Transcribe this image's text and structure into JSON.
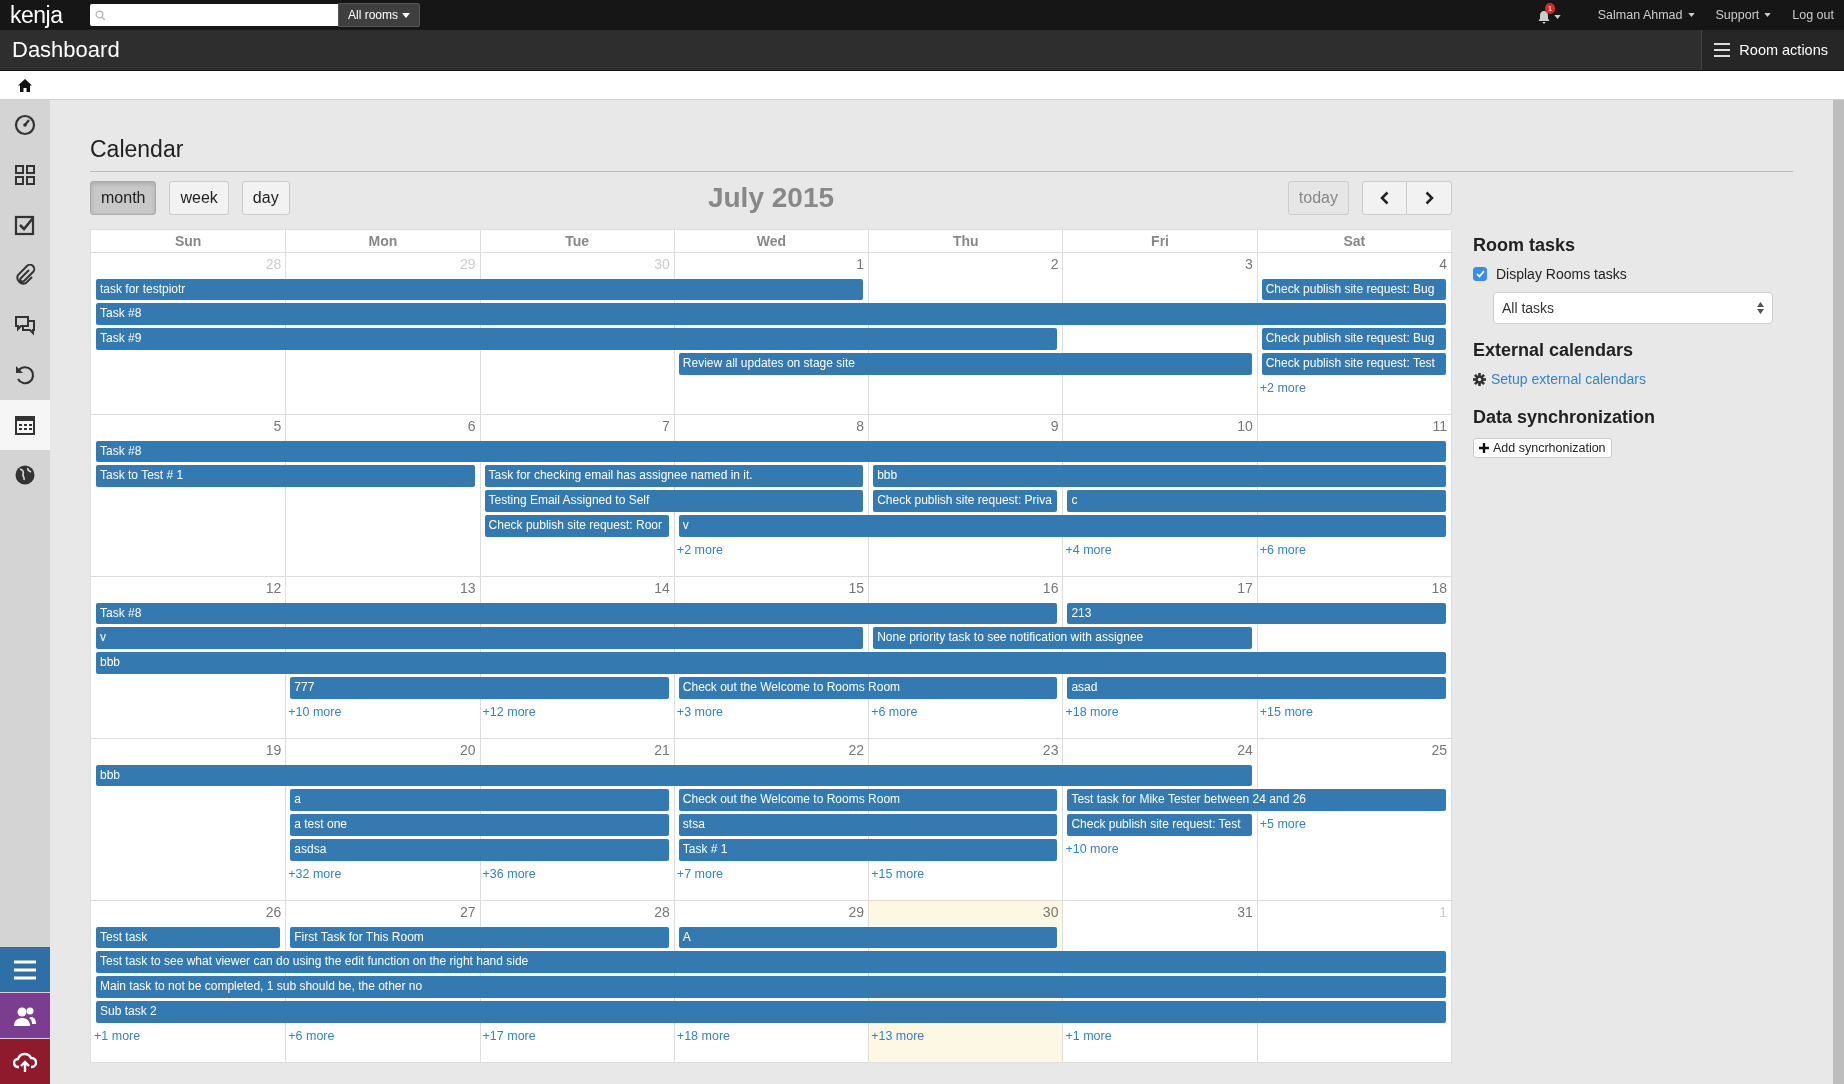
{
  "topbar": {
    "logo": "kenja",
    "room_filter": "All rooms",
    "notifications": "1",
    "user": "Salman Ahmad",
    "support": "Support",
    "logout": "Log out"
  },
  "header": {
    "title": "Dashboard",
    "actions": "Room actions"
  },
  "nav": {
    "items": [
      {
        "selected": false
      },
      {
        "selected": false
      },
      {
        "selected": false
      },
      {
        "selected": false
      },
      {
        "selected": false
      },
      {
        "selected": false
      },
      {
        "selected": true
      },
      {
        "selected": false
      }
    ],
    "bottom": [
      {
        "color": "#2f6fa8"
      },
      {
        "color": "#7b3d8f"
      },
      {
        "color": "#8e1a2b"
      }
    ]
  },
  "calendar": {
    "title": "Calendar",
    "views": [
      {
        "label": "month",
        "selected": true
      },
      {
        "label": "week",
        "selected": false
      },
      {
        "label": "day",
        "selected": false
      }
    ],
    "month_title": "July 2015",
    "today": "today",
    "weekdays": [
      "Sun",
      "Mon",
      "Tue",
      "Wed",
      "Thu",
      "Fri",
      "Sat"
    ],
    "weeks": [
      {
        "days": [
          {
            "num": "28",
            "other_month": true,
            "today": false
          },
          {
            "num": "29",
            "other_month": true,
            "today": false
          },
          {
            "num": "30",
            "other_month": true,
            "today": false
          },
          {
            "num": "1",
            "other_month": false,
            "today": false
          },
          {
            "num": "2",
            "other_month": false,
            "today": false
          },
          {
            "num": "3",
            "other_month": false,
            "today": false
          },
          {
            "num": "4",
            "other_month": false,
            "today": false
          }
        ],
        "lanes": [
          [
            {
              "kind": "start",
              "title": "task for testpiotr"
            },
            {
              "kind": "span"
            },
            {
              "kind": "span"
            },
            {
              "kind": "span"
            },
            {
              "kind": "empty"
            },
            {
              "kind": "empty"
            },
            {
              "kind": "start",
              "title": "Check publish site request: Bug"
            }
          ],
          [
            {
              "kind": "start",
              "title": "Task #8"
            },
            {
              "kind": "span"
            },
            {
              "kind": "span"
            },
            {
              "kind": "span"
            },
            {
              "kind": "span"
            },
            {
              "kind": "span"
            },
            {
              "kind": "span"
            }
          ],
          [
            {
              "kind": "start",
              "title": "Task #9"
            },
            {
              "kind": "span"
            },
            {
              "kind": "span"
            },
            {
              "kind": "span"
            },
            {
              "kind": "span"
            },
            {
              "kind": "empty"
            },
            {
              "kind": "start",
              "title": "Check publish site request: Bug"
            }
          ],
          [
            {
              "kind": "empty"
            },
            {
              "kind": "empty"
            },
            {
              "kind": "empty"
            },
            {
              "kind": "start",
              "title": "Review all updates on stage site"
            },
            {
              "kind": "span"
            },
            {
              "kind": "span"
            },
            {
              "kind": "start",
              "title": "Check publish site request: Test"
            }
          ],
          [
            {
              "kind": "empty"
            },
            {
              "kind": "empty"
            },
            {
              "kind": "empty"
            },
            {
              "kind": "empty"
            },
            {
              "kind": "empty"
            },
            {
              "kind": "empty"
            },
            {
              "kind": "more",
              "title": "+2 more"
            }
          ]
        ]
      },
      {
        "days": [
          {
            "num": "5",
            "other_month": false,
            "today": false
          },
          {
            "num": "6",
            "other_month": false,
            "today": false
          },
          {
            "num": "7",
            "other_month": false,
            "today": false
          },
          {
            "num": "8",
            "other_month": false,
            "today": false
          },
          {
            "num": "9",
            "other_month": false,
            "today": false
          },
          {
            "num": "10",
            "other_month": false,
            "today": false
          },
          {
            "num": "11",
            "other_month": false,
            "today": false
          }
        ],
        "lanes": [
          [
            {
              "kind": "start",
              "title": "Task #8"
            },
            {
              "kind": "span"
            },
            {
              "kind": "span"
            },
            {
              "kind": "span"
            },
            {
              "kind": "span"
            },
            {
              "kind": "span"
            },
            {
              "kind": "span"
            }
          ],
          [
            {
              "kind": "start",
              "title": "Task to Test # 1"
            },
            {
              "kind": "span"
            },
            {
              "kind": "start",
              "title": "Task for checking email has assignee named in it."
            },
            {
              "kind": "span"
            },
            {
              "kind": "start",
              "title": "bbb"
            },
            {
              "kind": "span"
            },
            {
              "kind": "span"
            }
          ],
          [
            {
              "kind": "empty"
            },
            {
              "kind": "empty"
            },
            {
              "kind": "start",
              "title": "Testing Email Assigned to Self"
            },
            {
              "kind": "span"
            },
            {
              "kind": "start",
              "title": "Check publish site request: Priva"
            },
            {
              "kind": "start",
              "title": "c"
            },
            {
              "kind": "span"
            }
          ],
          [
            {
              "kind": "empty"
            },
            {
              "kind": "empty"
            },
            {
              "kind": "start",
              "title": "Check publish site request: Roor"
            },
            {
              "kind": "start",
              "title": "v"
            },
            {
              "kind": "span"
            },
            {
              "kind": "span"
            },
            {
              "kind": "span"
            }
          ],
          [
            {
              "kind": "empty"
            },
            {
              "kind": "empty"
            },
            {
              "kind": "empty"
            },
            {
              "kind": "more",
              "title": "+2 more"
            },
            {
              "kind": "empty"
            },
            {
              "kind": "more",
              "title": "+4 more"
            },
            {
              "kind": "more",
              "title": "+6 more"
            }
          ]
        ]
      },
      {
        "days": [
          {
            "num": "12",
            "other_month": false,
            "today": false
          },
          {
            "num": "13",
            "other_month": false,
            "today": false
          },
          {
            "num": "14",
            "other_month": false,
            "today": false
          },
          {
            "num": "15",
            "other_month": false,
            "today": false
          },
          {
            "num": "16",
            "other_month": false,
            "today": false
          },
          {
            "num": "17",
            "other_month": false,
            "today": false
          },
          {
            "num": "18",
            "other_month": false,
            "today": false
          }
        ],
        "lanes": [
          [
            {
              "kind": "start",
              "title": "Task #8"
            },
            {
              "kind": "span"
            },
            {
              "kind": "span"
            },
            {
              "kind": "span"
            },
            {
              "kind": "span"
            },
            {
              "kind": "start",
              "title": "213"
            },
            {
              "kind": "span"
            }
          ],
          [
            {
              "kind": "start",
              "title": "v"
            },
            {
              "kind": "span"
            },
            {
              "kind": "span"
            },
            {
              "kind": "span"
            },
            {
              "kind": "start",
              "title": "None priority task to see notification with assignee"
            },
            {
              "kind": "span"
            },
            {
              "kind": "empty"
            }
          ],
          [
            {
              "kind": "start",
              "title": "bbb"
            },
            {
              "kind": "span"
            },
            {
              "kind": "span"
            },
            {
              "kind": "span"
            },
            {
              "kind": "span"
            },
            {
              "kind": "span"
            },
            {
              "kind": "span"
            }
          ],
          [
            {
              "kind": "empty"
            },
            {
              "kind": "start",
              "title": "777"
            },
            {
              "kind": "span"
            },
            {
              "kind": "start",
              "title": "Check out the Welcome to Rooms Room"
            },
            {
              "kind": "span"
            },
            {
              "kind": "start",
              "title": "asad"
            },
            {
              "kind": "span"
            }
          ],
          [
            {
              "kind": "empty"
            },
            {
              "kind": "more",
              "title": "+10 more"
            },
            {
              "kind": "more",
              "title": "+12 more"
            },
            {
              "kind": "more",
              "title": "+3 more"
            },
            {
              "kind": "more",
              "title": "+6 more"
            },
            {
              "kind": "more",
              "title": "+18 more"
            },
            {
              "kind": "more",
              "title": "+15 more"
            }
          ]
        ]
      },
      {
        "days": [
          {
            "num": "19",
            "other_month": false,
            "today": false
          },
          {
            "num": "20",
            "other_month": false,
            "today": false
          },
          {
            "num": "21",
            "other_month": false,
            "today": false
          },
          {
            "num": "22",
            "other_month": false,
            "today": false
          },
          {
            "num": "23",
            "other_month": false,
            "today": false
          },
          {
            "num": "24",
            "other_month": false,
            "today": false
          },
          {
            "num": "25",
            "other_month": false,
            "today": false
          }
        ],
        "lanes": [
          [
            {
              "kind": "start",
              "title": "bbb"
            },
            {
              "kind": "span"
            },
            {
              "kind": "span"
            },
            {
              "kind": "span"
            },
            {
              "kind": "span"
            },
            {
              "kind": "span"
            },
            {
              "kind": "empty"
            }
          ],
          [
            {
              "kind": "empty"
            },
            {
              "kind": "start",
              "title": "a"
            },
            {
              "kind": "span"
            },
            {
              "kind": "start",
              "title": "Check out the Welcome to Rooms Room"
            },
            {
              "kind": "span"
            },
            {
              "kind": "start",
              "title": "Test task for Mike Tester between 24 and 26"
            },
            {
              "kind": "span"
            }
          ],
          [
            {
              "kind": "empty"
            },
            {
              "kind": "start",
              "title": "a test one"
            },
            {
              "kind": "span"
            },
            {
              "kind": "start",
              "title": "stsa"
            },
            {
              "kind": "span"
            },
            {
              "kind": "start",
              "title": "Check publish site request: Test"
            },
            {
              "kind": "more",
              "title": "+5 more"
            }
          ],
          [
            {
              "kind": "empty"
            },
            {
              "kind": "start",
              "title": "asdsa"
            },
            {
              "kind": "span"
            },
            {
              "kind": "start",
              "title": "Task # 1"
            },
            {
              "kind": "span"
            },
            {
              "kind": "more",
              "title": "+10 more"
            },
            {
              "kind": "empty"
            }
          ],
          [
            {
              "kind": "empty"
            },
            {
              "kind": "more",
              "title": "+32 more"
            },
            {
              "kind": "more",
              "title": "+36 more"
            },
            {
              "kind": "more",
              "title": "+7 more"
            },
            {
              "kind": "more",
              "title": "+15 more"
            },
            {
              "kind": "empty"
            },
            {
              "kind": "empty"
            }
          ]
        ]
      },
      {
        "days": [
          {
            "num": "26",
            "other_month": false,
            "today": false
          },
          {
            "num": "27",
            "other_month": false,
            "today": false
          },
          {
            "num": "28",
            "other_month": false,
            "today": false
          },
          {
            "num": "29",
            "other_month": false,
            "today": false
          },
          {
            "num": "30",
            "other_month": false,
            "today": true
          },
          {
            "num": "31",
            "other_month": false,
            "today": false
          },
          {
            "num": "1",
            "other_month": true,
            "today": false
          }
        ],
        "lanes": [
          [
            {
              "kind": "start",
              "title": "Test task"
            },
            {
              "kind": "start",
              "title": "First Task for This Room"
            },
            {
              "kind": "span"
            },
            {
              "kind": "start",
              "title": "A"
            },
            {
              "kind": "span"
            },
            {
              "kind": "empty"
            },
            {
              "kind": "empty"
            }
          ],
          [
            {
              "kind": "start",
              "title": "Test task to see what viewer can do using the edit function on the right hand side"
            },
            {
              "kind": "span"
            },
            {
              "kind": "span"
            },
            {
              "kind": "span"
            },
            {
              "kind": "span"
            },
            {
              "kind": "span"
            },
            {
              "kind": "span"
            }
          ],
          [
            {
              "kind": "start",
              "title": "Main task to not be completed, 1 sub should be, the other no"
            },
            {
              "kind": "span"
            },
            {
              "kind": "span"
            },
            {
              "kind": "span"
            },
            {
              "kind": "span"
            },
            {
              "kind": "span"
            },
            {
              "kind": "span"
            }
          ],
          [
            {
              "kind": "start",
              "title": "Sub task 2"
            },
            {
              "kind": "span"
            },
            {
              "kind": "span"
            },
            {
              "kind": "span"
            },
            {
              "kind": "span"
            },
            {
              "kind": "span"
            },
            {
              "kind": "span"
            }
          ],
          [
            {
              "kind": "more",
              "title": "+1 more"
            },
            {
              "kind": "more",
              "title": "+6 more"
            },
            {
              "kind": "more",
              "title": "+17 more"
            },
            {
              "kind": "more",
              "title": "+18 more"
            },
            {
              "kind": "more",
              "title": "+13 more"
            },
            {
              "kind": "more",
              "title": "+1 more"
            },
            {
              "kind": "empty"
            }
          ]
        ]
      }
    ]
  },
  "side": {
    "room_tasks": {
      "title": "Room tasks",
      "display_label": "Display Rooms tasks",
      "checked": true,
      "filter": "All tasks"
    },
    "external": {
      "title": "External calendars",
      "link": "Setup external calendars"
    },
    "sync": {
      "title": "Data synchronization",
      "button": "Add syncrhonization"
    }
  }
}
